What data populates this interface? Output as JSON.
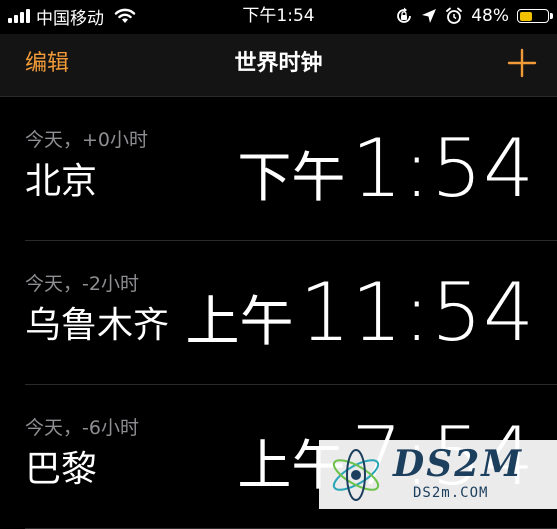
{
  "status_bar": {
    "carrier": "中国移动",
    "time": "下午1:54",
    "battery_percent": "48%",
    "battery_level": 0.48,
    "icons": [
      "signal-icon",
      "wifi-icon",
      "rotation-lock-icon",
      "location-icon",
      "alarm-icon",
      "battery-icon"
    ]
  },
  "nav": {
    "edit_label": "编辑",
    "title": "世界时钟",
    "add_icon": "plus-icon"
  },
  "clocks": [
    {
      "offset": "今天，+0小时",
      "city": "北京",
      "ampm": "下午",
      "time": "1:54"
    },
    {
      "offset": "今天，-2小时",
      "city": "乌鲁木齐",
      "ampm": "上午",
      "time": "11:54"
    },
    {
      "offset": "今天，-6小时",
      "city": "巴黎",
      "ampm": "上午",
      "time": "7:54"
    }
  ],
  "watermark": {
    "brand": "DS2M",
    "url": "DS2m.COM"
  },
  "colors": {
    "accent": "#f19a38",
    "background": "#000000",
    "nav_background": "#141414",
    "secondary_text": "#8e8e93",
    "battery": "#f2c200"
  }
}
